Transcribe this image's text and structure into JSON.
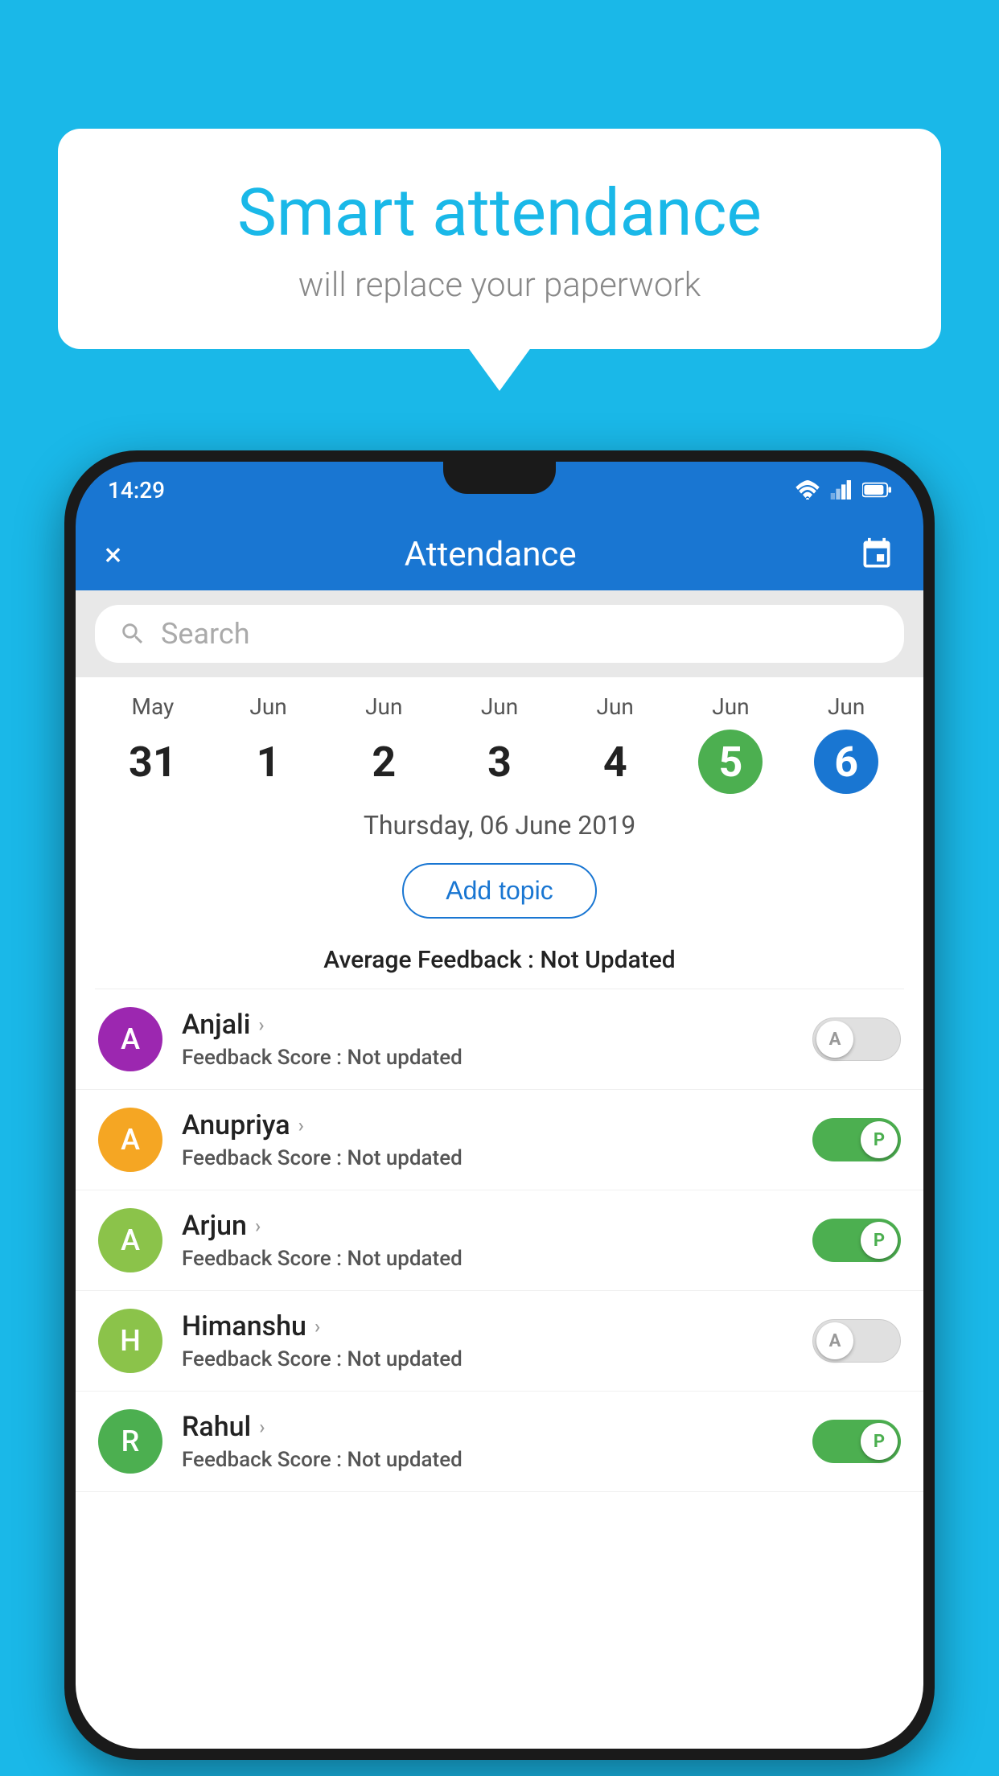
{
  "background_color": "#1ab8e8",
  "speech_bubble": {
    "title": "Smart attendance",
    "subtitle": "will replace your paperwork"
  },
  "status_bar": {
    "time": "14:29"
  },
  "app_bar": {
    "close_label": "×",
    "title": "Attendance",
    "calendar_icon": "📅"
  },
  "search": {
    "placeholder": "Search"
  },
  "calendar": {
    "columns": [
      {
        "month": "May",
        "day": "31",
        "style": "normal"
      },
      {
        "month": "Jun",
        "day": "1",
        "style": "normal"
      },
      {
        "month": "Jun",
        "day": "2",
        "style": "normal"
      },
      {
        "month": "Jun",
        "day": "3",
        "style": "normal"
      },
      {
        "month": "Jun",
        "day": "4",
        "style": "normal"
      },
      {
        "month": "Jun",
        "day": "5",
        "style": "green"
      },
      {
        "month": "Jun",
        "day": "6",
        "style": "blue"
      }
    ]
  },
  "selected_date": "Thursday, 06 June 2019",
  "add_topic_label": "Add topic",
  "avg_feedback_label": "Average Feedback : ",
  "avg_feedback_value": "Not Updated",
  "students": [
    {
      "name": "Anjali",
      "initial": "A",
      "avatar_color": "#9c27b0",
      "score_label": "Feedback Score : ",
      "score_value": "Not updated",
      "toggle": "off",
      "toggle_letter": "A"
    },
    {
      "name": "Anupriya",
      "initial": "A",
      "avatar_color": "#f5a623",
      "score_label": "Feedback Score : ",
      "score_value": "Not updated",
      "toggle": "on",
      "toggle_letter": "P"
    },
    {
      "name": "Arjun",
      "initial": "A",
      "avatar_color": "#8bc34a",
      "score_label": "Feedback Score : ",
      "score_value": "Not updated",
      "toggle": "on",
      "toggle_letter": "P"
    },
    {
      "name": "Himanshu",
      "initial": "H",
      "avatar_color": "#8bc34a",
      "score_label": "Feedback Score : ",
      "score_value": "Not updated",
      "toggle": "off",
      "toggle_letter": "A"
    },
    {
      "name": "Rahul",
      "initial": "R",
      "avatar_color": "#4caf50",
      "score_label": "Feedback Score : ",
      "score_value": "Not updated",
      "toggle": "on",
      "toggle_letter": "P"
    }
  ]
}
